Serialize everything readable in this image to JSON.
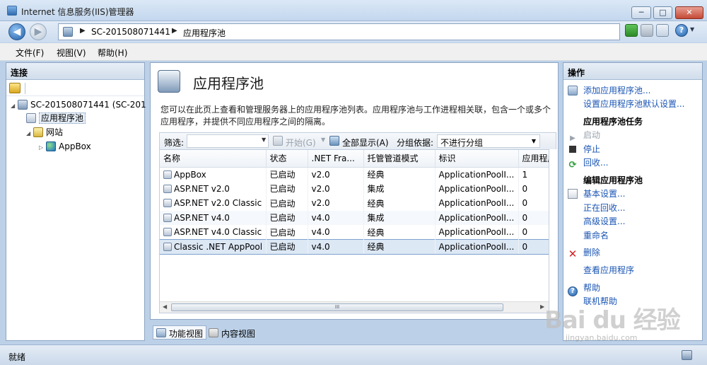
{
  "window": {
    "title": "Internet 信息服务(IIS)管理器",
    "min_label": "─",
    "max_label": "□",
    "close_label": "✕"
  },
  "address": {
    "segments": [
      "SC-201508071441",
      "应用程序池"
    ],
    "arrow": "▶"
  },
  "toolbar": {
    "help_label": "?",
    "help_dd": "▼"
  },
  "menu": [
    "文件(F)",
    "视图(V)",
    "帮助(H)"
  ],
  "connections": {
    "title": "连接",
    "tree": [
      {
        "label": "SC-201508071441 (SC-201",
        "twisty": "◢",
        "icon": "server-icon"
      },
      {
        "label": "应用程序池",
        "twisty": "",
        "icon": "app-pool-icon"
      },
      {
        "label": "网站",
        "twisty": "◢",
        "icon": "sites-icon"
      },
      {
        "label": "AppBox",
        "twisty": "▷",
        "icon": "globe-icon"
      }
    ]
  },
  "main": {
    "title": "应用程序池",
    "description": "您可以在此页上查看和管理服务器上的应用程序池列表。应用程序池与工作进程相关联，包含一个或多个应用程序，并提供不同应用程序之间的隔离。",
    "filter": {
      "label": "筛选:",
      "start_label": "开始(G)",
      "show_all_label": "全部显示(A)",
      "group_by_label": "分组依据:",
      "group_by_value": "不进行分组",
      "dd": "▼",
      "sep_dd": "▼"
    },
    "columns": [
      "名称",
      "状态",
      ".NET Fra...",
      "托管管道模式",
      "标识",
      "应用程序"
    ],
    "rows": [
      [
        "AppBox",
        "已启动",
        "v2.0",
        "经典",
        "ApplicationPoolI...",
        "1"
      ],
      [
        "ASP.NET v2.0",
        "已启动",
        "v2.0",
        "集成",
        "ApplicationPoolI...",
        "0"
      ],
      [
        "ASP.NET v2.0 Classic",
        "已启动",
        "v2.0",
        "经典",
        "ApplicationPoolI...",
        "0"
      ],
      [
        "ASP.NET v4.0",
        "已启动",
        "v4.0",
        "集成",
        "ApplicationPoolI...",
        "0"
      ],
      [
        "ASP.NET v4.0 Classic",
        "已启动",
        "v4.0",
        "经典",
        "ApplicationPoolI...",
        "0"
      ],
      [
        "Classic .NET AppPool",
        "已启动",
        "v4.0",
        "经典",
        "ApplicationPoolI...",
        "0"
      ]
    ],
    "scroll_grip": "III",
    "scroll_left": "◀",
    "scroll_right": "▶"
  },
  "view_tabs": [
    "功能视图",
    "内容视图"
  ],
  "actions": {
    "title": "操作",
    "add_pool": "添加应用程序池...",
    "set_defaults": "设置应用程序池默认设置...",
    "pool_tasks_heading": "应用程序池任务",
    "start": "启动",
    "stop": "停止",
    "recycle": "回收...",
    "edit_heading": "编辑应用程序池",
    "basic_settings": "基本设置...",
    "recycling": "正在回收...",
    "advanced_settings": "高级设置...",
    "rename": "重命名",
    "delete": "删除",
    "view_apps": "查看应用程序",
    "help": "帮助",
    "online_help": "联机帮助"
  },
  "status": {
    "text": "就绪"
  },
  "watermark": {
    "main": "Bai du 经验",
    "sub": "jingyan.baidu.com"
  }
}
